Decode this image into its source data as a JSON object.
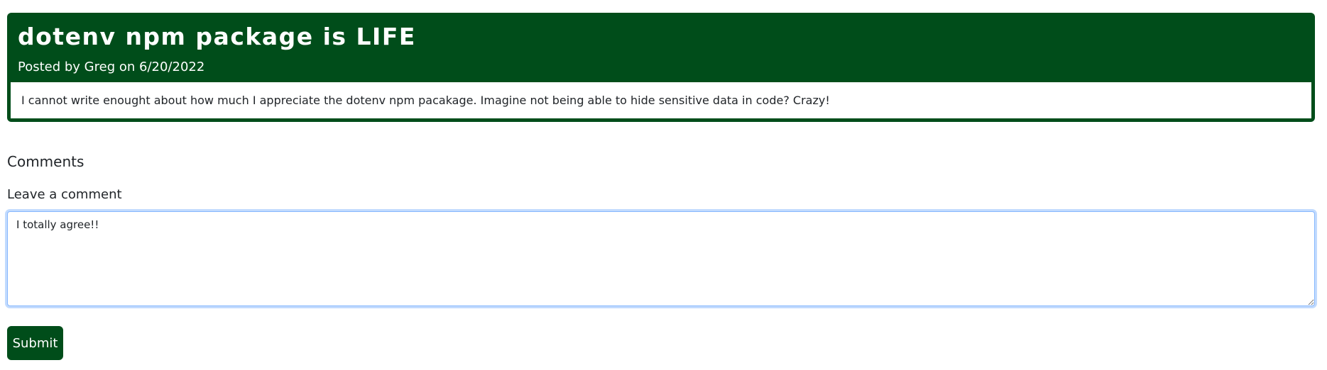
{
  "post": {
    "title": "dotenv npm package is LIFE",
    "meta": "Posted by Greg on 6/20/2022",
    "body": "I cannot write enought about how much I appreciate the dotenv npm pacakage. Imagine not being able to hide sensitive data in code? Crazy!"
  },
  "comments": {
    "heading": "Comments",
    "label": "Leave a comment",
    "textarea_value": "I totally agree!!",
    "submit_label": "Submit"
  },
  "colors": {
    "brand_green": "#004d1a",
    "focus_blue": "#86b7fe"
  }
}
